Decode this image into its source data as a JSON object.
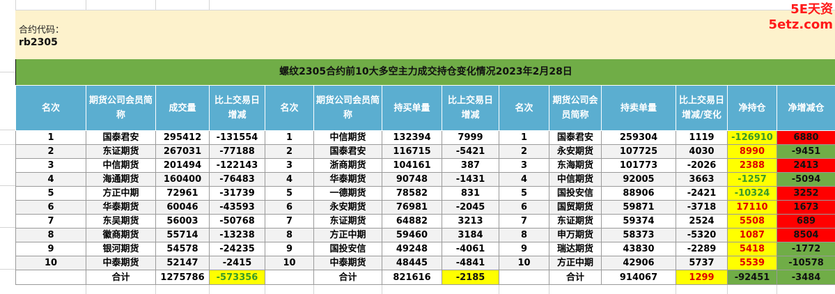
{
  "watermark": "5E天资5etz.com",
  "contract": {
    "label": "合约代码：",
    "code": "rb2305"
  },
  "title": "螺纹2305合约前10大多空主力成交持仓变化情况2023年2月28日",
  "headers": [
    "名次",
    "期货公司会员简称",
    "成交量",
    "比上交易日增减",
    "名次",
    "期货公司会员简称",
    "持买单量",
    "比上交易日增减",
    "名次",
    "期货公司会员简称",
    "持卖单量",
    "比上交易日增减/变化",
    "净持仓",
    "净增减仓"
  ],
  "rows": [
    [
      "1",
      "国泰君安",
      "295412",
      "-131554",
      "1",
      "中信期货",
      "132394",
      "7999",
      "1",
      "国泰君安",
      "259304",
      "1119",
      "-126910",
      "6880"
    ],
    [
      "2",
      "东证期货",
      "267031",
      "-77188",
      "2",
      "国泰君安",
      "116715",
      "-5421",
      "2",
      "永安期货",
      "107725",
      "4030",
      "8990",
      "-9451"
    ],
    [
      "3",
      "中信期货",
      "201494",
      "-122143",
      "3",
      "浙商期货",
      "104161",
      "387",
      "3",
      "东海期货",
      "101773",
      "-2026",
      "2388",
      "2413"
    ],
    [
      "4",
      "海通期货",
      "160400",
      "-76483",
      "4",
      "华泰期货",
      "90748",
      "-1431",
      "4",
      "中信期货",
      "92005",
      "3663",
      "-1257",
      "-5094"
    ],
    [
      "5",
      "方正中期",
      "72961",
      "-31739",
      "5",
      "一德期货",
      "78582",
      "831",
      "5",
      "国投安信",
      "88906",
      "-2421",
      "-10324",
      "3252"
    ],
    [
      "6",
      "华泰期货",
      "60046",
      "-43593",
      "6",
      "永安期货",
      "76981",
      "-2045",
      "6",
      "国贸期货",
      "59871",
      "-3718",
      "17110",
      "1673"
    ],
    [
      "7",
      "东吴期货",
      "56003",
      "-50768",
      "7",
      "东证期货",
      "64882",
      "3213",
      "7",
      "东证期货",
      "59374",
      "2524",
      "5508",
      "689"
    ],
    [
      "8",
      "徽商期货",
      "55714",
      "-13238",
      "8",
      "方正中期",
      "59460",
      "3184",
      "8",
      "申万期货",
      "58373",
      "-5320",
      "1087",
      "8504"
    ],
    [
      "9",
      "银河期货",
      "54578",
      "-24235",
      "9",
      "国投安信",
      "49248",
      "-4061",
      "9",
      "瑞达期货",
      "43830",
      "-2289",
      "5418",
      "-1772"
    ],
    [
      "10",
      "中泰期货",
      "52147",
      "-2415",
      "10",
      "中泰期货",
      "48445",
      "-4841",
      "10",
      "方正中期",
      "42906",
      "5737",
      "5539",
      "-10578"
    ]
  ],
  "total": [
    "",
    "合计",
    "1275786",
    "-573356",
    "",
    "合计",
    "821616",
    "-2185",
    "",
    "合计",
    "914067",
    "1299",
    "-92451",
    "-3484"
  ],
  "colors": {
    "header_bg": "#5baed0",
    "title_bg": "#70ad47",
    "info_bg": "#fdf2cc",
    "watermark": "#ff1a1a"
  }
}
